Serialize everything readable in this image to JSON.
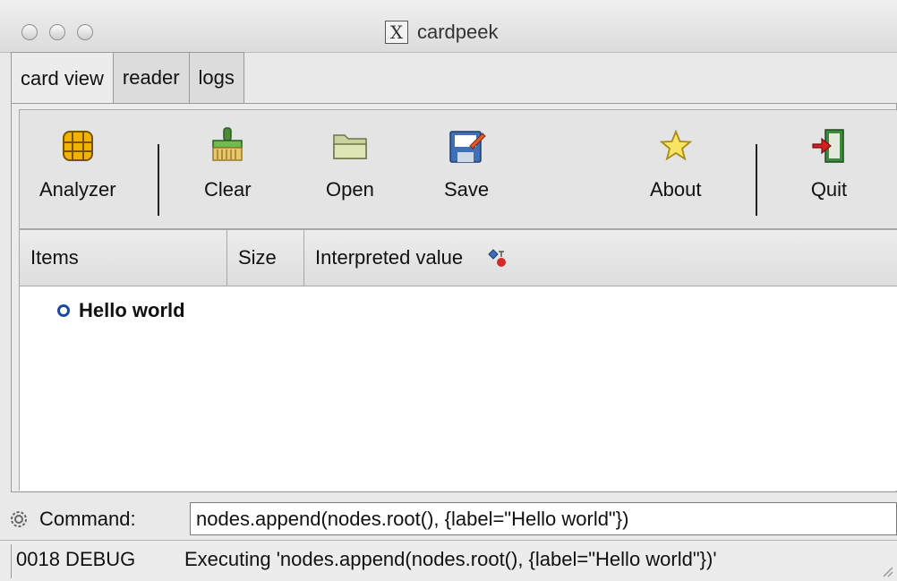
{
  "window": {
    "title": "cardpeek",
    "x_icon": "X"
  },
  "tabs": [
    {
      "label": "card view"
    },
    {
      "label": "reader"
    },
    {
      "label": "logs"
    }
  ],
  "toolbar": {
    "analyzer": "Analyzer",
    "clear": "Clear",
    "open": "Open",
    "save": "Save",
    "about": "About",
    "quit": "Quit"
  },
  "columns": {
    "items": "Items",
    "size": "Size",
    "interpreted": "Interpreted value"
  },
  "tree": {
    "root_label": "Hello world"
  },
  "command": {
    "label": "Command:",
    "value": "nodes.append(nodes.root(), {label=\"Hello world\"})"
  },
  "status": {
    "code": "0018 DEBUG",
    "message": "Executing 'nodes.append(nodes.root(), {label=\"Hello world\"})'"
  },
  "colors": {
    "accent": "#1d4aa0"
  }
}
